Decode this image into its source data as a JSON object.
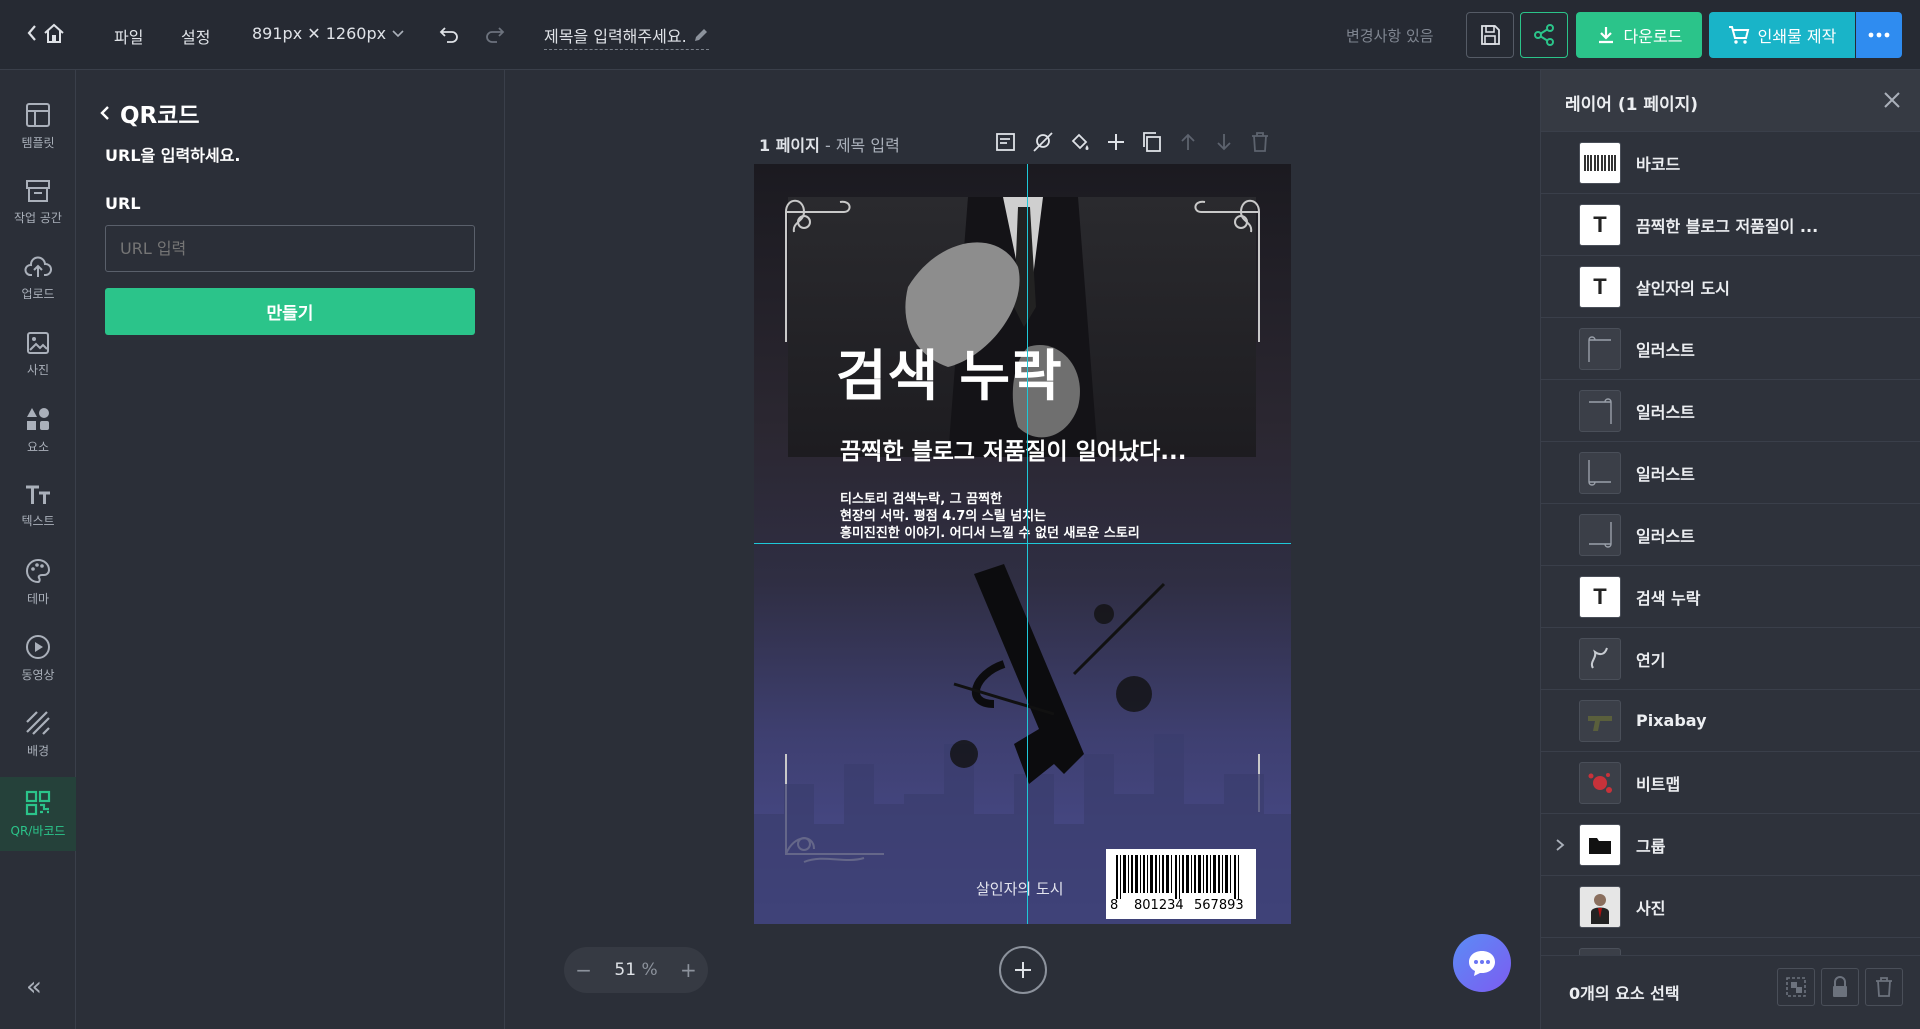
{
  "topbar": {
    "file_label": "파일",
    "settings_label": "설정",
    "size_label": "891px ✕ 1260px",
    "title_placeholder": "제목을 입력해주세요.",
    "changes_label": "변경사항 있음",
    "download_label": "다운로드",
    "print_label": "인쇄물 제작"
  },
  "leftnav": {
    "items": [
      {
        "label": "템플릿"
      },
      {
        "label": "작업 공간"
      },
      {
        "label": "업로드"
      },
      {
        "label": "사진"
      },
      {
        "label": "요소"
      },
      {
        "label": "텍스트"
      },
      {
        "label": "테마"
      },
      {
        "label": "동영상"
      },
      {
        "label": "배경"
      },
      {
        "label": "QR/바코드"
      }
    ],
    "collapse_label": "«"
  },
  "panel": {
    "title": "QR코드",
    "instruction": "URL을 입력하세요.",
    "url_label": "URL",
    "url_placeholder": "URL 입력",
    "make_button": "만들기"
  },
  "canvas": {
    "page_label": "1 페이지",
    "page_title": " - 제목 입력",
    "poster_title": "검색 누락",
    "poster_subtitle": "끔찍한 블로그 저품질이 일어났다...",
    "poster_body_1": "티스토리 검색누락, 그 끔찍한",
    "poster_body_2": "현장의 서막. 평점 4.7의 스릴 넘치는",
    "poster_body_3": "흥미진진한 이야기. 어디서 느낄 수 없던 새로운 스토리",
    "poster_footer": "살인자의 도시",
    "barcode_left": "8",
    "barcode_mid": "801234",
    "barcode_right": "567893",
    "zoom_value": "51",
    "zoom_unit": "%"
  },
  "rightpanel": {
    "title": "레이어 (1 페이지)",
    "layers": [
      {
        "name": "바코드",
        "icon": "barcode-thumb"
      },
      {
        "name": "끔찍한 블로그 저품질이 ...",
        "icon": "text-thumb"
      },
      {
        "name": "살인자의 도시",
        "icon": "text-thumb"
      },
      {
        "name": "일러스트",
        "icon": "illust-thumb"
      },
      {
        "name": "일러스트",
        "icon": "illust-thumb"
      },
      {
        "name": "일러스트",
        "icon": "illust-thumb"
      },
      {
        "name": "일러스트",
        "icon": "illust-thumb"
      },
      {
        "name": "검색 누락",
        "icon": "text-thumb"
      },
      {
        "name": "연기",
        "icon": "smoke-thumb"
      },
      {
        "name": "Pixabay",
        "icon": "gun-thumb"
      },
      {
        "name": "비트맵",
        "icon": "splash-thumb"
      },
      {
        "name": "그룹",
        "icon": "folder-thumb"
      },
      {
        "name": "사진",
        "icon": "photo-thumb"
      }
    ],
    "selected_count": "0개의 요소 선택"
  },
  "colors": {
    "accent_green": "#2bc48a",
    "accent_teal": "#19b4c8",
    "accent_blue": "#2f8cf0",
    "guide": "#1ec8d8"
  }
}
